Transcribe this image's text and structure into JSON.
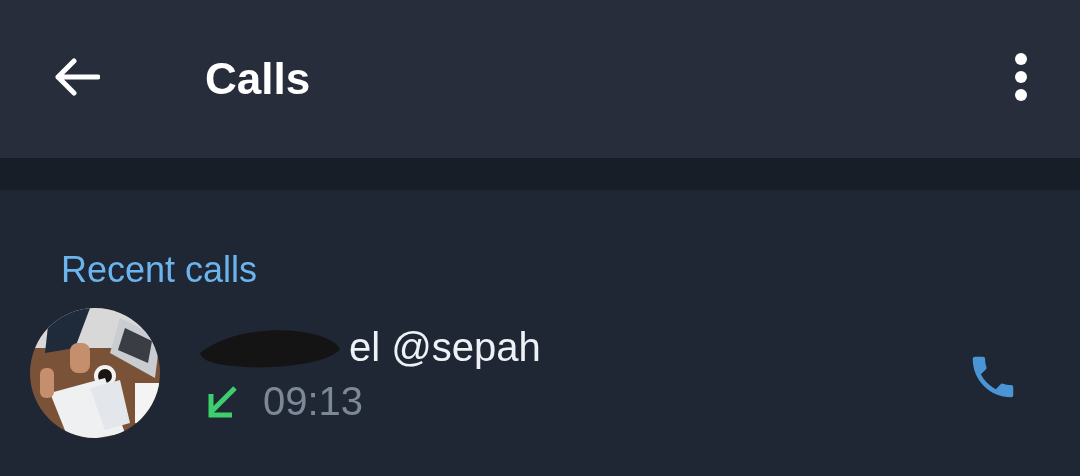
{
  "header": {
    "title": "Calls"
  },
  "section": {
    "title": "Recent calls"
  },
  "calls": [
    {
      "kind": "picture",
      "name": "el @sepah",
      "name_redacted": true,
      "incoming": true,
      "time": "09:13"
    }
  ]
}
